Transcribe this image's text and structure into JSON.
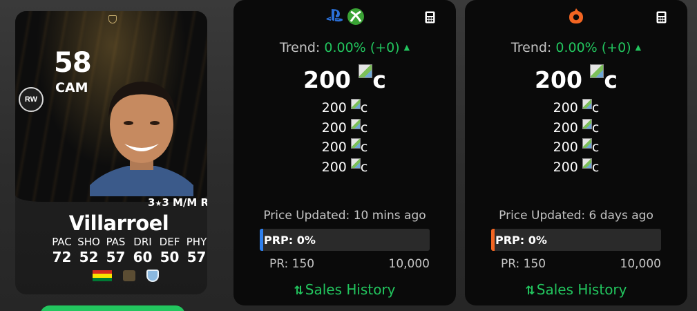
{
  "card": {
    "rating": "58",
    "position": "CAM",
    "alt_position": "RW",
    "skills_prefix": "3",
    "skills_suffix": "3 M/M R",
    "name": "Villarroel",
    "stats": [
      {
        "label": "PAC",
        "value": "72"
      },
      {
        "label": "SHO",
        "value": "52"
      },
      {
        "label": "PAS",
        "value": "57"
      },
      {
        "label": "DRI",
        "value": "60"
      },
      {
        "label": "DEF",
        "value": "50"
      },
      {
        "label": "PHY",
        "value": "57"
      }
    ],
    "flag_colors": [
      "#d52b1e",
      "#f9e300",
      "#007934"
    ],
    "club_color": "#8bb9e0"
  },
  "panels": [
    {
      "platform_icons": [
        "playstation-icon",
        "xbox-icon"
      ],
      "trend_label": "Trend:",
      "trend_value": "0.00% (+0)",
      "main_price": "200",
      "coin_alt": "c",
      "alt_prices": [
        "200",
        "200",
        "200",
        "200"
      ],
      "updated": "Price Updated: 10 mins ago",
      "prp_label": "PRP: 0%",
      "prp_percent": 0,
      "accent_color": "#2f80ed",
      "pr_min": "PR: 150",
      "pr_max": "10,000",
      "sales_history": "Sales History"
    },
    {
      "platform_icons": [
        "origin-icon"
      ],
      "trend_label": "Trend:",
      "trend_value": "0.00% (+0)",
      "main_price": "200",
      "coin_alt": "c",
      "alt_prices": [
        "200",
        "200",
        "200",
        "200"
      ],
      "updated": "Price Updated: 6 days ago",
      "prp_label": "PRP: 0%",
      "prp_percent": 0,
      "accent_color": "#f26522",
      "pr_min": "PR: 150",
      "pr_max": "10,000",
      "sales_history": "Sales History"
    }
  ],
  "colors": {
    "positive": "#22c55e",
    "panel_bg": "#0a0a0a",
    "muted_text": "#c4c4c4"
  }
}
